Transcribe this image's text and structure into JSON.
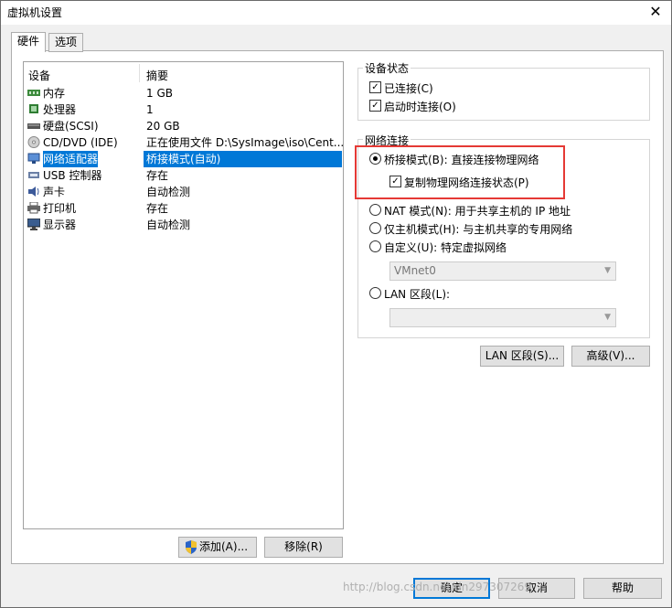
{
  "window": {
    "title": "虚拟机设置"
  },
  "tabs": [
    {
      "label": "硬件"
    },
    {
      "label": "选项"
    }
  ],
  "device_list": {
    "headers": {
      "device": "设备",
      "summary": "摘要"
    },
    "rows": [
      {
        "icon": "memory-icon",
        "name": "内存",
        "summary": "1 GB"
      },
      {
        "icon": "processor-icon",
        "name": "处理器",
        "summary": "1"
      },
      {
        "icon": "disk-icon",
        "name": "硬盘(SCSI)",
        "summary": "20 GB"
      },
      {
        "icon": "cd-icon",
        "name": "CD/DVD (IDE)",
        "summary": "正在使用文件 D:\\SysImage\\iso\\Cent..."
      },
      {
        "icon": "network-icon",
        "name": "网络适配器",
        "summary": "桥接模式(自动)"
      },
      {
        "icon": "usb-icon",
        "name": "USB 控制器",
        "summary": "存在"
      },
      {
        "icon": "sound-icon",
        "name": "声卡",
        "summary": "自动检测"
      },
      {
        "icon": "printer-icon",
        "name": "打印机",
        "summary": "存在"
      },
      {
        "icon": "monitor-icon",
        "name": "显示器",
        "summary": "自动检测"
      }
    ],
    "selected_index": 4
  },
  "device_status": {
    "label": "设备状态",
    "connected": {
      "label": "已连接(C)",
      "checked": true
    },
    "connect_at_power_on": {
      "label": "启动时连接(O)",
      "checked": true
    }
  },
  "network": {
    "label": "网络连接",
    "bridged": {
      "label": "桥接模式(B): 直接连接物理网络",
      "selected": true
    },
    "replicate": {
      "label": "复制物理网络连接状态(P)",
      "checked": true
    },
    "nat": {
      "label": "NAT 模式(N): 用于共享主机的 IP 地址",
      "selected": false
    },
    "host_only": {
      "label": "仅主机模式(H): 与主机共享的专用网络",
      "selected": false
    },
    "custom": {
      "label": "自定义(U): 特定虚拟网络",
      "selected": false
    },
    "custom_value": "VMnet0",
    "lan_segment": {
      "label": "LAN 区段(L):",
      "selected": false
    },
    "lan_segment_value": ""
  },
  "buttons": {
    "lan_segments": "LAN 区段(S)...",
    "advanced": "高级(V)...",
    "add": "添加(A)...",
    "remove": "移除(R)",
    "ok": "确定",
    "cancel": "取消",
    "help": "帮助"
  },
  "watermark": "http://blog.csdn.net/dn297307269",
  "colors": {
    "selection": "#0078d7",
    "highlight_box": "#e53935"
  }
}
